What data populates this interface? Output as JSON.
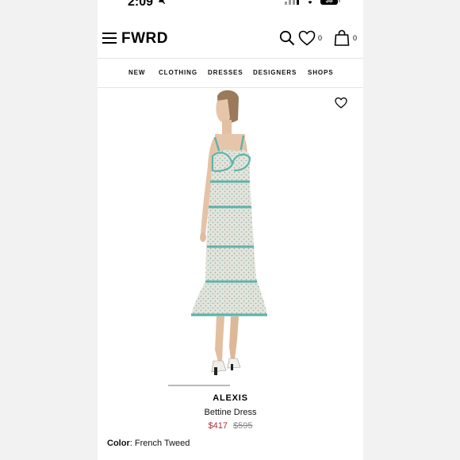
{
  "status_bar": {
    "time": "2:09",
    "battery": "38"
  },
  "header": {
    "logo": "FWRD",
    "wishlist_count": "0",
    "bag_count": "0"
  },
  "nav": {
    "items": [
      "NEW",
      "CLOTHING",
      "DRESSES",
      "DESIGNERS",
      "SHOPS"
    ]
  },
  "product": {
    "brand": "ALEXIS",
    "name": "Bettine Dress",
    "price": "$417",
    "original_price": "$595",
    "color_label": "Color",
    "color_value": "French Tweed",
    "image_carousel_progress": 1.0
  },
  "icons": {
    "menu": "hamburger-icon",
    "search": "search-icon",
    "wishlist": "heart-icon",
    "bag": "shopping-bag-icon",
    "favorite": "heart-outline-icon"
  },
  "colors": {
    "sale_price": "#a8323b",
    "trim": "#5fb3a8"
  }
}
